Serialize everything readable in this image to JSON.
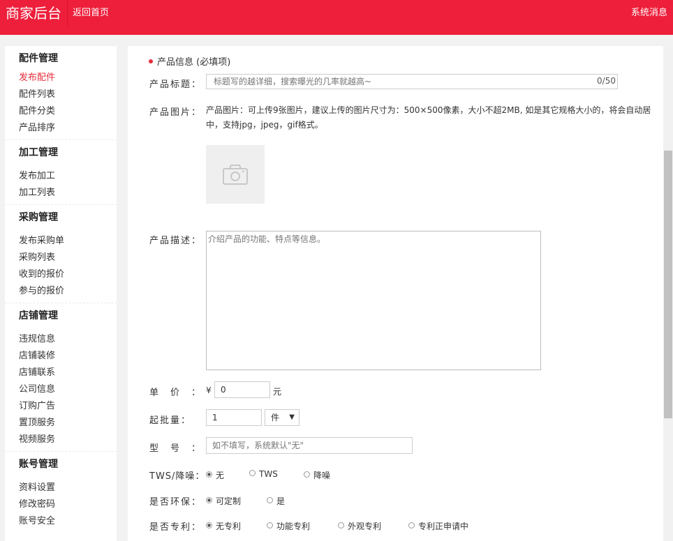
{
  "header": {
    "brand": "商家后台",
    "home_link": "返回首页",
    "messages_link": "系统消息"
  },
  "sidebar": {
    "groups": [
      {
        "title": "配件管理",
        "items": [
          "发布配件",
          "配件列表",
          "配件分类",
          "产品排序"
        ],
        "active": "发布配件"
      },
      {
        "title": "加工管理",
        "items": [
          "发布加工",
          "加工列表"
        ]
      },
      {
        "title": "采购管理",
        "items": [
          "发布采购单",
          "采购列表",
          "收到的报价",
          "参与的报价"
        ]
      },
      {
        "title": "店铺管理",
        "items": [
          "违规信息",
          "店铺装修",
          "店铺联系",
          "公司信息",
          "订购广告",
          "置顶服务",
          "视频服务"
        ]
      },
      {
        "title": "账号管理",
        "items": [
          "资料设置",
          "修改密码",
          "账号安全"
        ]
      }
    ]
  },
  "form": {
    "section_title": "产品信息 (必填项)",
    "title_label": "产品标题：",
    "title_placeholder": "标题写的越详细，搜索曝光的几率就越高~",
    "title_counter": "0/50",
    "image_label": "产品图片：",
    "image_note": "产品图片：可上传9张图片，建议上传的图片尺寸为：500×500像素，大小不超2MB, 如是其它规格大小的，将会自动居中，支持jpg，jpeg，gif格式。",
    "image_icon": "camera-icon",
    "desc_label": "产品描述：",
    "desc_placeholder": "介绍产品的功能、特点等信息。",
    "price_label": "单　价　：",
    "price_symbol": "¥",
    "price_value": "0",
    "price_unit": "元",
    "moq_label": "起批量：",
    "moq_value": "1",
    "moq_unit": "件",
    "model_label": "型　号　：",
    "model_placeholder": "如不填写，系统默认\"无\"",
    "tws_label": "TWS/降噪：",
    "tws_options": [
      "无",
      "TWS",
      "降噪"
    ],
    "tws_selected": "无",
    "eco_label": "是否环保：",
    "eco_options": [
      "可定制",
      "是"
    ],
    "eco_selected": "可定制",
    "patent_label": "是否专利：",
    "patent_options": [
      "无专利",
      "功能专利",
      "外观专利",
      "专利正申请中"
    ],
    "patent_selected": "无专利"
  },
  "colors": {
    "header_red": "#ee1f3b",
    "active_red": "#e62e3c"
  }
}
